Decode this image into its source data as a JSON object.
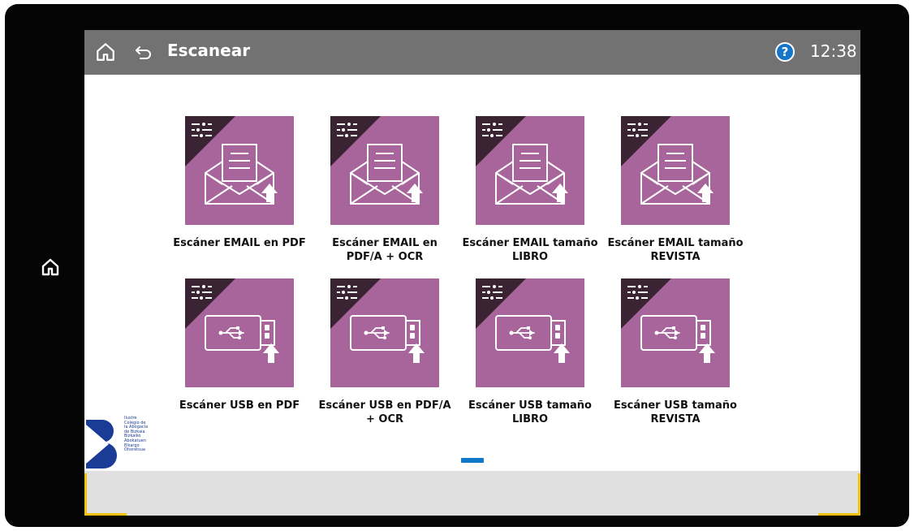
{
  "header": {
    "title": "Escanear",
    "clock": "12:38",
    "help_label": "?"
  },
  "tiles": [
    {
      "label": "Escáner EMAIL en PDF",
      "kind": "email"
    },
    {
      "label": "Escáner EMAIL en PDF/A + OCR",
      "kind": "email"
    },
    {
      "label": "Escáner EMAIL tamaño LIBRO",
      "kind": "email"
    },
    {
      "label": "Escáner EMAIL tamaño REVISTA",
      "kind": "email"
    },
    {
      "label": "Escáner USB en PDF",
      "kind": "usb"
    },
    {
      "label": "Escáner USB en PDF/A + OCR",
      "kind": "usb"
    },
    {
      "label": "Escáner USB tamaño LIBRO",
      "kind": "usb"
    },
    {
      "label": "Escáner USB tamaño REVISTA",
      "kind": "usb"
    }
  ],
  "pager": {
    "current_page": 1
  },
  "logo": {
    "lines": [
      "Ilustre",
      "Colegio de",
      "la Abogacía",
      "de Bizkaia",
      "Bizkaiko",
      "Abokatuen",
      "Elkargo",
      "Ohoretsua"
    ]
  },
  "colors": {
    "tile_bg": "#a7659b",
    "topbar_bg": "#727272",
    "accent_corner": "#f2c40f",
    "pager": "#0f78c9"
  }
}
